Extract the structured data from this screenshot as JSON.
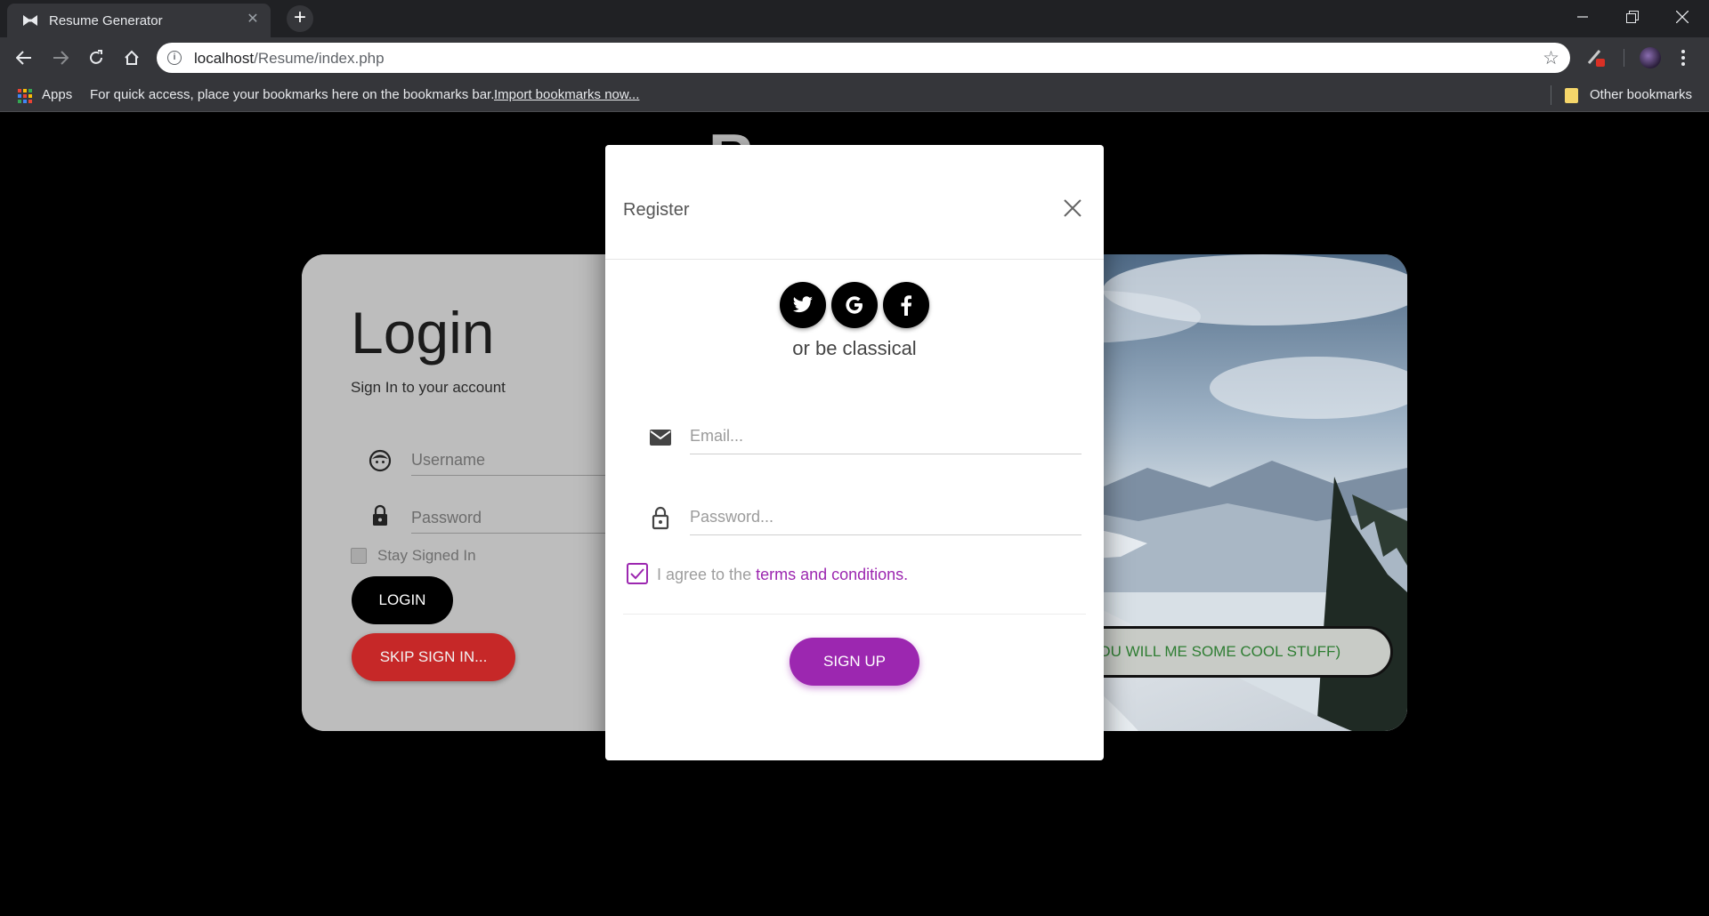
{
  "browser": {
    "tab_title": "Resume Generator",
    "tab_close": "✕",
    "new_tab": "+",
    "url_host": "localhost",
    "url_path": "/Resume/index.php",
    "bookmarks": {
      "apps_label": "Apps",
      "message": "For quick access, place your bookmarks here on the bookmarks bar.",
      "import_link": "Import bookmarks now...",
      "other": "Other bookmarks"
    }
  },
  "page": {
    "background_heading": "R",
    "login": {
      "title": "Login",
      "subtitle": "Sign In to your account",
      "username_placeholder": "Username",
      "password_placeholder": "Password",
      "stay_signed_in": "Stay Signed In",
      "login_button": "LOGIN",
      "skip_button": "SKIP SIGN IN..."
    },
    "photo_button": "(IF YOU WILL ME SOME COOL STUFF)"
  },
  "modal": {
    "title": "Register",
    "or_text": "or be classical",
    "email_placeholder": "Email...",
    "password_placeholder": "Password...",
    "agree_prefix": "I agree to the ",
    "agree_link": "terms and conditions",
    "agree_suffix": ".",
    "agree_checked": true,
    "signup_button": "SIGN UP",
    "social": [
      "twitter-icon",
      "google-icon",
      "facebook-icon"
    ]
  },
  "colors": {
    "accent": "#9c27b0",
    "skip_red": "#c62828",
    "photo_button_text": "#2e7d32"
  }
}
